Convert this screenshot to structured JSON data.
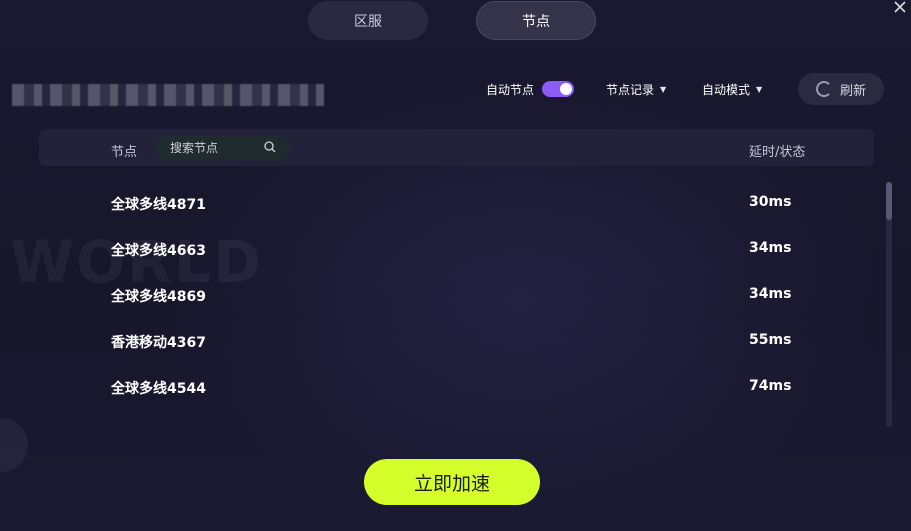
{
  "tabs": [
    {
      "label": "区服",
      "active": false
    },
    {
      "label": "节点",
      "active": true
    }
  ],
  "toolbar": {
    "auto_node_label": "自动节点",
    "auto_node_enabled": true,
    "node_record_label": "节点记录",
    "auto_mode_label": "自动模式",
    "refresh_label": "刷新"
  },
  "table": {
    "header_node": "节点",
    "search_placeholder": "搜索节点",
    "header_latency": "延时/状态",
    "rows": [
      {
        "name": "全球多线4871",
        "latency": "30ms"
      },
      {
        "name": "全球多线4663",
        "latency": "34ms"
      },
      {
        "name": "全球多线4869",
        "latency": "34ms"
      },
      {
        "name": "香港移动4367",
        "latency": "55ms"
      },
      {
        "name": "全球多线4544",
        "latency": "74ms"
      }
    ]
  },
  "actions": {
    "accelerate_label": "立即加速"
  },
  "colors": {
    "background": "#18172a",
    "toggle_on": "#8b5cf6",
    "accelerate_button": "#d4ff2a",
    "panel": "#23223a"
  }
}
